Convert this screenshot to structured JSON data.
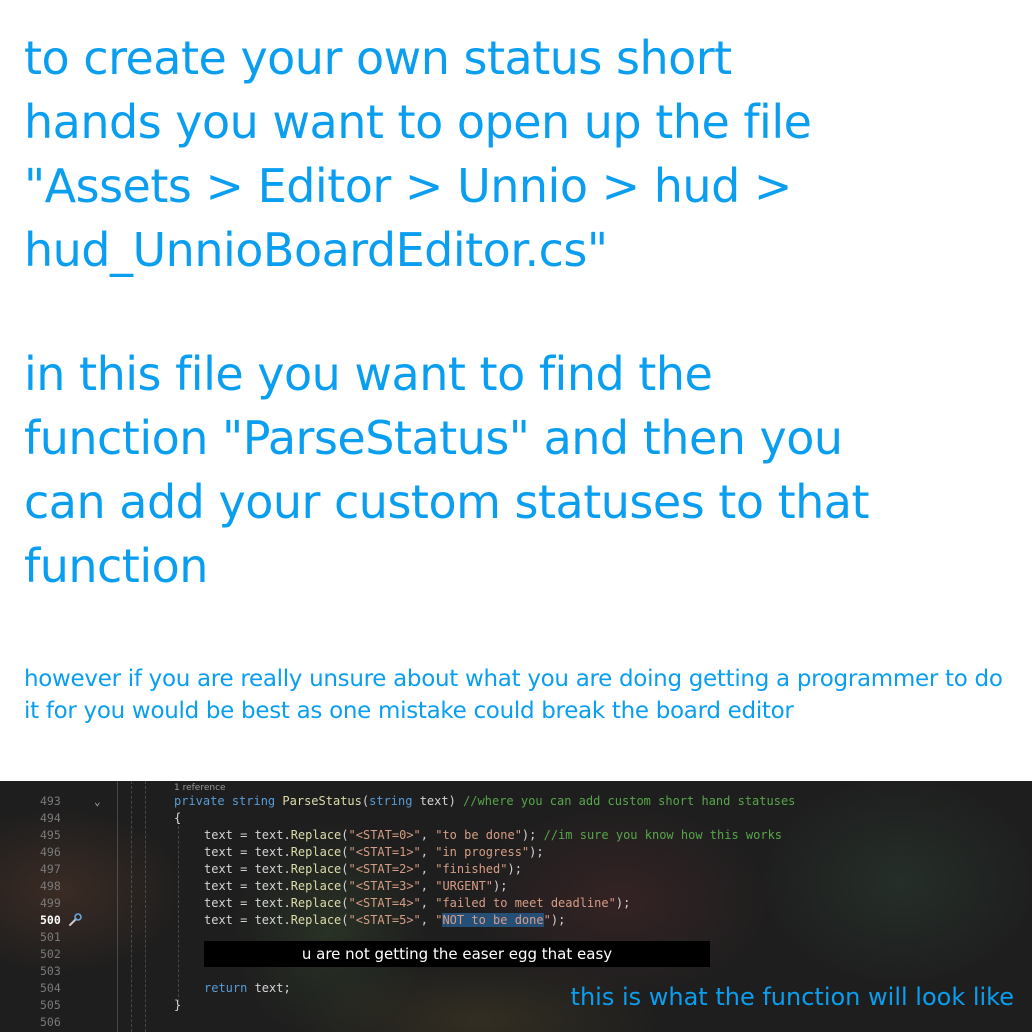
{
  "instructions": {
    "paragraph1": "to create your own status short\nhands  you want to open up the file\n\"Assets > Editor > Unnio > hud >\nhud_UnnioBoardEditor.cs\"",
    "paragraph2": "in this file you want to find the\nfunction \"ParseStatus\" and then you\ncan add your custom statuses to that\nfunction",
    "paragraph3": "however if you are really unsure about what you are doing getting a programmer to do it for you would be best as one mistake could break the board editor"
  },
  "editor": {
    "reference_hint": "1 reference",
    "lines": [
      {
        "number": "493",
        "kw": "private",
        "kw2": "string",
        "fn": "ParseStatus",
        "open": "(",
        "kw3": "string",
        "param": " text)",
        "comment": " //where you can add custom short hand statuses"
      },
      {
        "number": "494",
        "text": "{"
      },
      {
        "number": "495",
        "lhs": "text = text.",
        "call": "Replace",
        "open": "(",
        "arg1": "\"<STAT=0>\"",
        "sep": ", ",
        "arg2": "\"to be done\"",
        "close": ");",
        "comment": " //im sure you know how this works"
      },
      {
        "number": "496",
        "lhs": "text = text.",
        "call": "Replace",
        "open": "(",
        "arg1": "\"<STAT=1>\"",
        "sep": ", ",
        "arg2": "\"in progress\"",
        "close": ");"
      },
      {
        "number": "497",
        "lhs": "text = text.",
        "call": "Replace",
        "open": "(",
        "arg1": "\"<STAT=2>\"",
        "sep": ", ",
        "arg2": "\"finished\"",
        "close": ");"
      },
      {
        "number": "498",
        "lhs": "text = text.",
        "call": "Replace",
        "open": "(",
        "arg1": "\"<STAT=3>\"",
        "sep": ", ",
        "arg2": "\"URGENT\"",
        "close": ");"
      },
      {
        "number": "499",
        "lhs": "text = text.",
        "call": "Replace",
        "open": "(",
        "arg1": "\"<STAT=4>\"",
        "sep": ", ",
        "arg2": "\"failed to meet deadline\"",
        "close": ");"
      },
      {
        "number": "500",
        "lhs": "text = text.",
        "call": "Replace",
        "open": "(",
        "arg1": "\"<STAT=5>\"",
        "sep": ", ",
        "arg2_pre": "\"",
        "arg2_sel": "NOT to be done",
        "arg2_post": "\"",
        "close": ");"
      },
      {
        "number": "501"
      },
      {
        "number": "502"
      },
      {
        "number": "503"
      },
      {
        "number": "504",
        "kw": "return",
        "rest": " text;"
      },
      {
        "number": "505",
        "text": "}"
      },
      {
        "number": "506"
      }
    ],
    "caption": "u are not getting the easer egg that easy",
    "overlay_note": "this is what the function will look like",
    "colors": {
      "background": "#1e1e1e",
      "keyword": "#569cd6",
      "function": "#dcdcaa",
      "string": "#d69d85",
      "comment": "#57a64a",
      "selection": "#264f78"
    },
    "icons": {
      "fold": "chevron-down-icon",
      "quick_action": "wrench-icon"
    }
  }
}
